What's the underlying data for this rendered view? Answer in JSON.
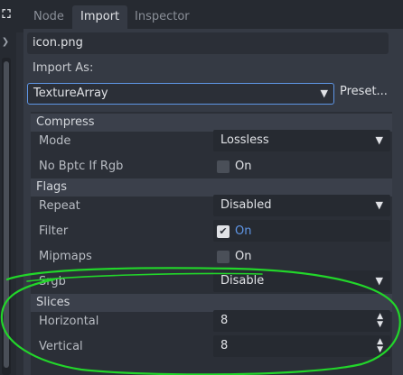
{
  "tabs": [
    {
      "label": "Node",
      "active": false
    },
    {
      "label": "Import",
      "active": true
    },
    {
      "label": "Inspector",
      "active": false
    }
  ],
  "import": {
    "filename": "icon.png",
    "import_as_label": "Import As:",
    "import_as_value": "TextureArray",
    "preset_label": "Preset..."
  },
  "sections": {
    "compress": "Compress",
    "flags": "Flags",
    "slices": "Slices"
  },
  "properties": {
    "mode": {
      "label": "Mode",
      "value": "Lossless"
    },
    "no_bptc": {
      "label": "No Bptc If Rgb",
      "value": "On",
      "checked": false
    },
    "repeat": {
      "label": "Repeat",
      "value": "Disabled"
    },
    "filter": {
      "label": "Filter",
      "value": "On",
      "checked": true
    },
    "mipmaps": {
      "label": "Mipmaps",
      "value": "On",
      "checked": false
    },
    "srgb": {
      "label": "Srgb",
      "value": "Disable"
    },
    "horizontal": {
      "label": "Horizontal",
      "value": "8"
    },
    "vertical": {
      "label": "Vertical",
      "value": "8"
    }
  },
  "colors": {
    "accent": "#5f96e6",
    "annotation": "#22d62a",
    "panel_bg": "#353a44",
    "field_bg": "#262a31"
  },
  "icons": {
    "left_top": "fullscreen-icon",
    "left_chevron": "chevron-right-icon",
    "dropdown": "chevron-down-icon",
    "spinner": "up-down-arrows-icon",
    "check": "checkmark-icon"
  }
}
